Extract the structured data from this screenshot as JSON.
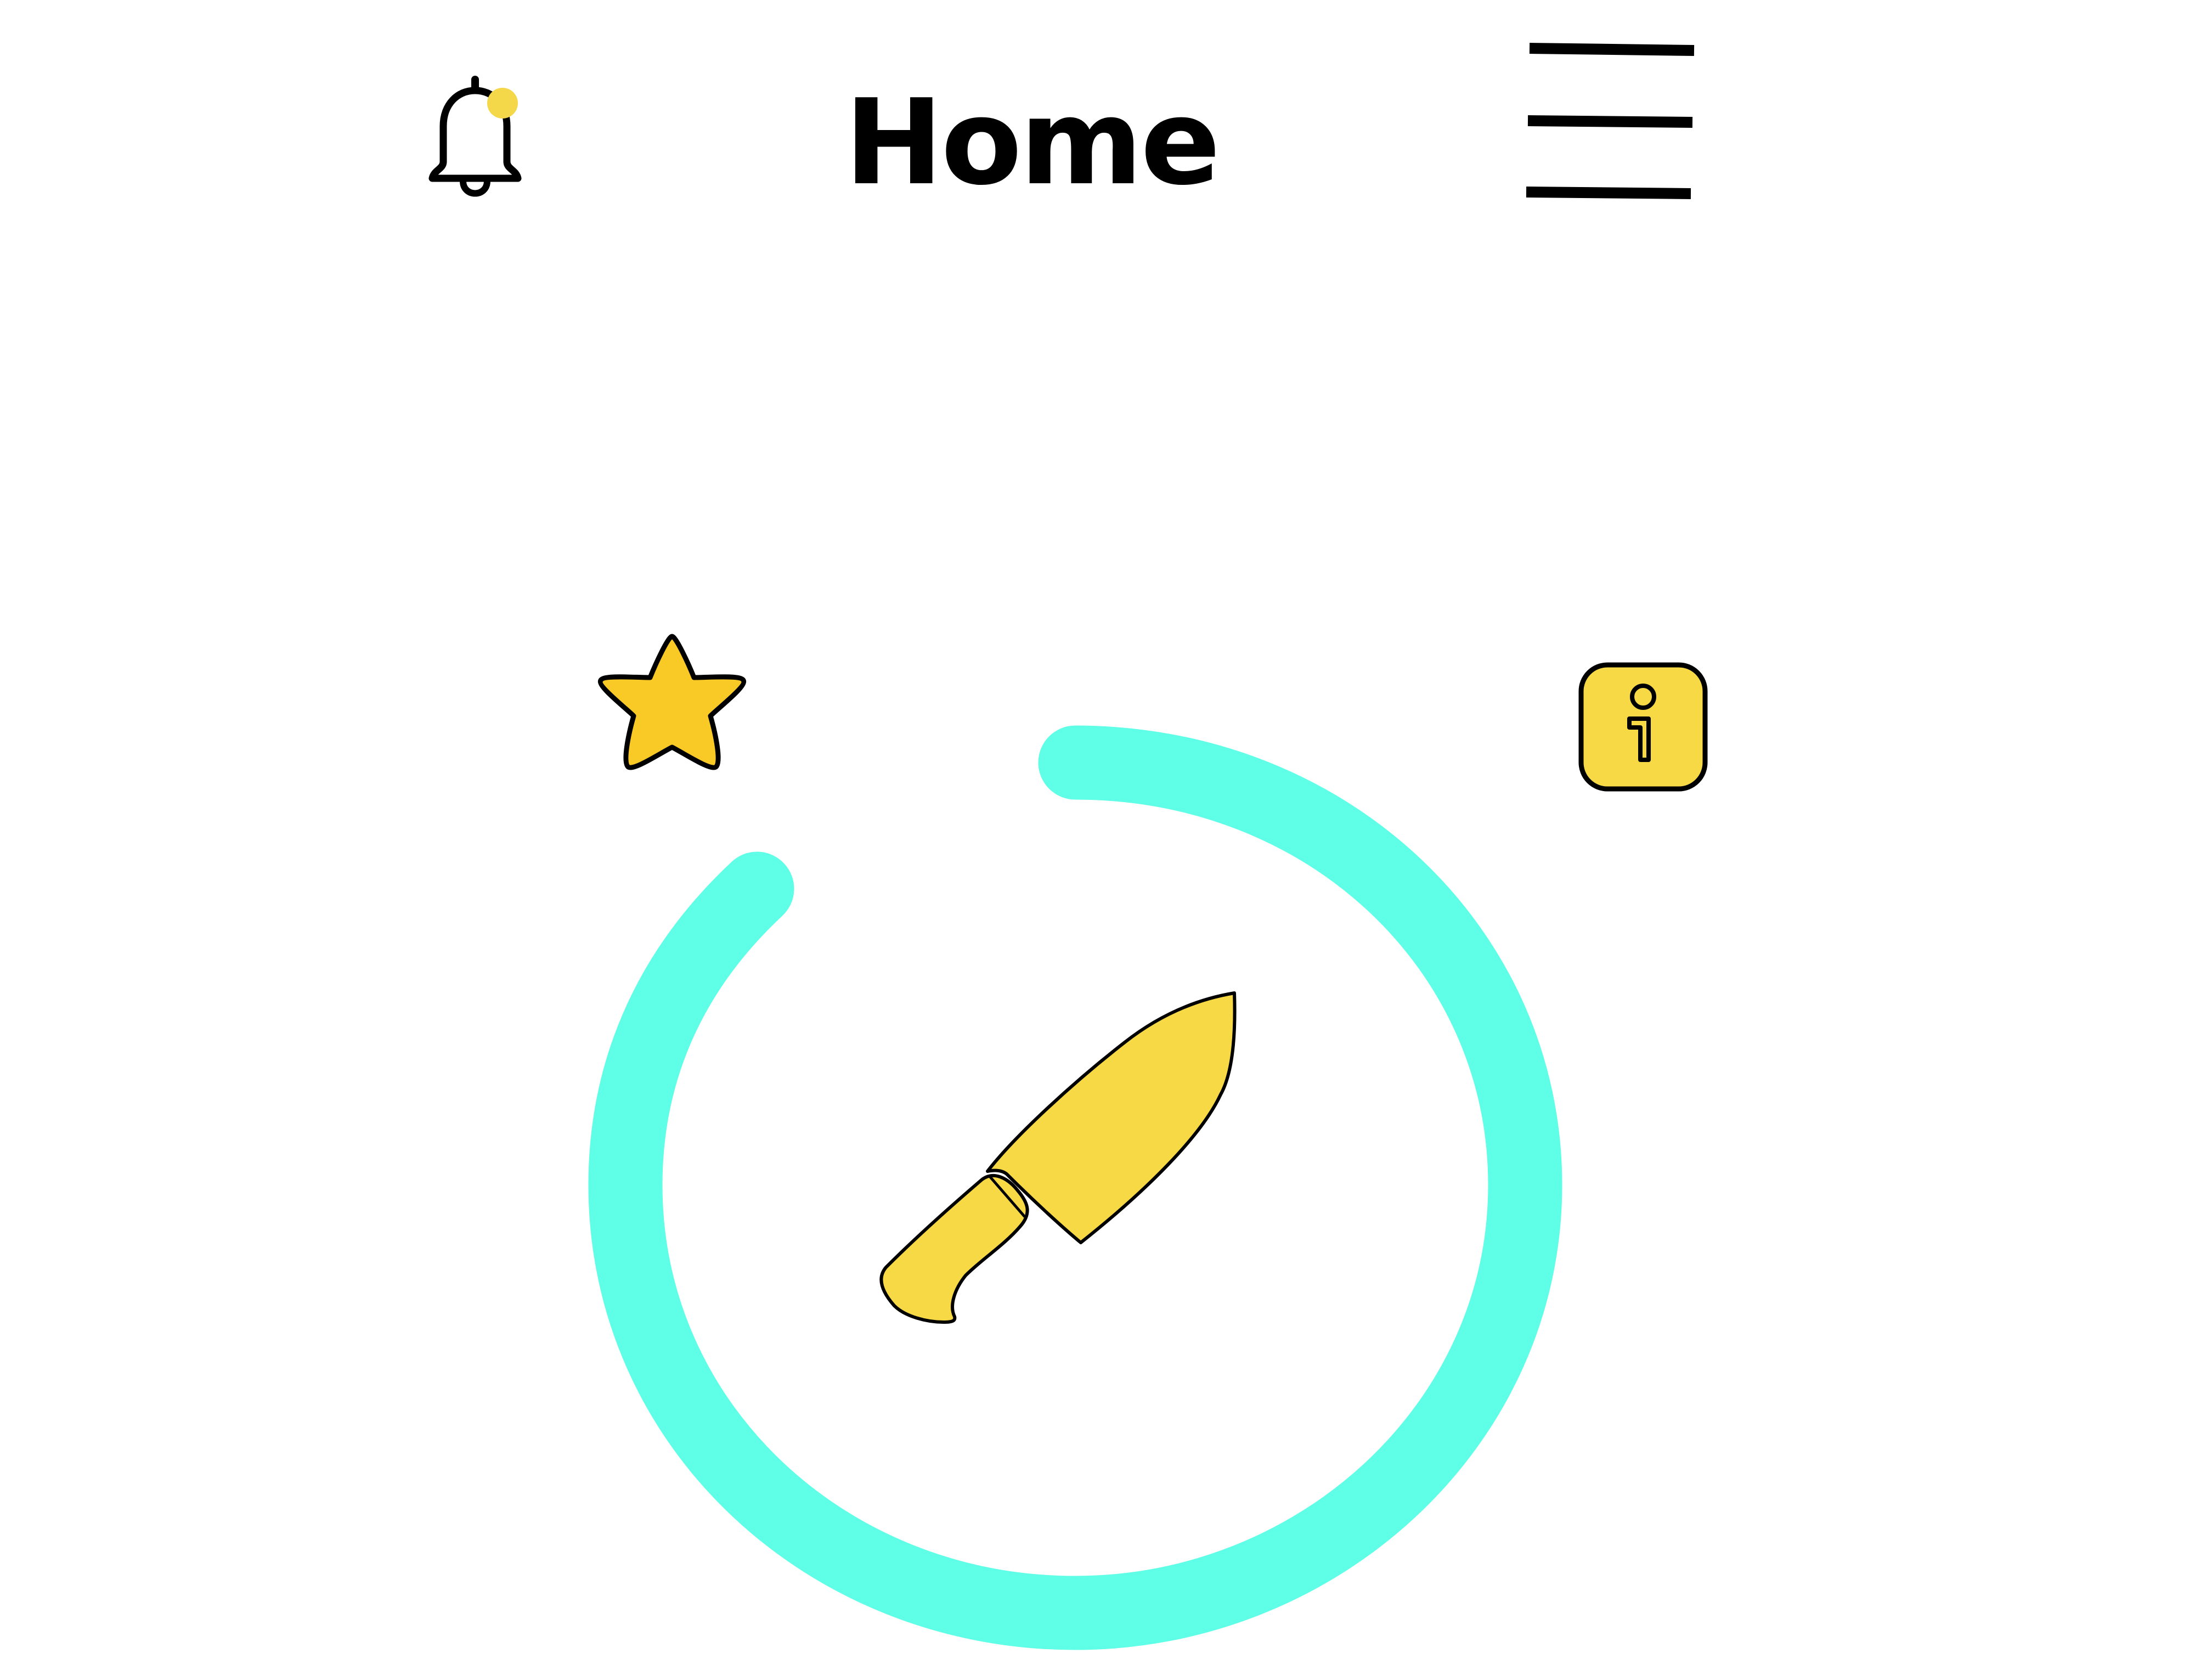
{
  "header": {
    "title": "Home",
    "notification_icon": "bell-icon",
    "notification_badge_color": "#f5d84a",
    "menu_icon": "hamburger-menu-icon"
  },
  "card": {
    "favorite_icon": "star-icon",
    "info_icon": "info-icon",
    "center_icon": "knife-icon",
    "timer_progress": 0.88
  },
  "colors": {
    "background": "#ffffff",
    "ring": "#5effe6",
    "accent_yellow": "#f6d945",
    "star_yellow": "#f9c926",
    "ink": "#000000"
  }
}
